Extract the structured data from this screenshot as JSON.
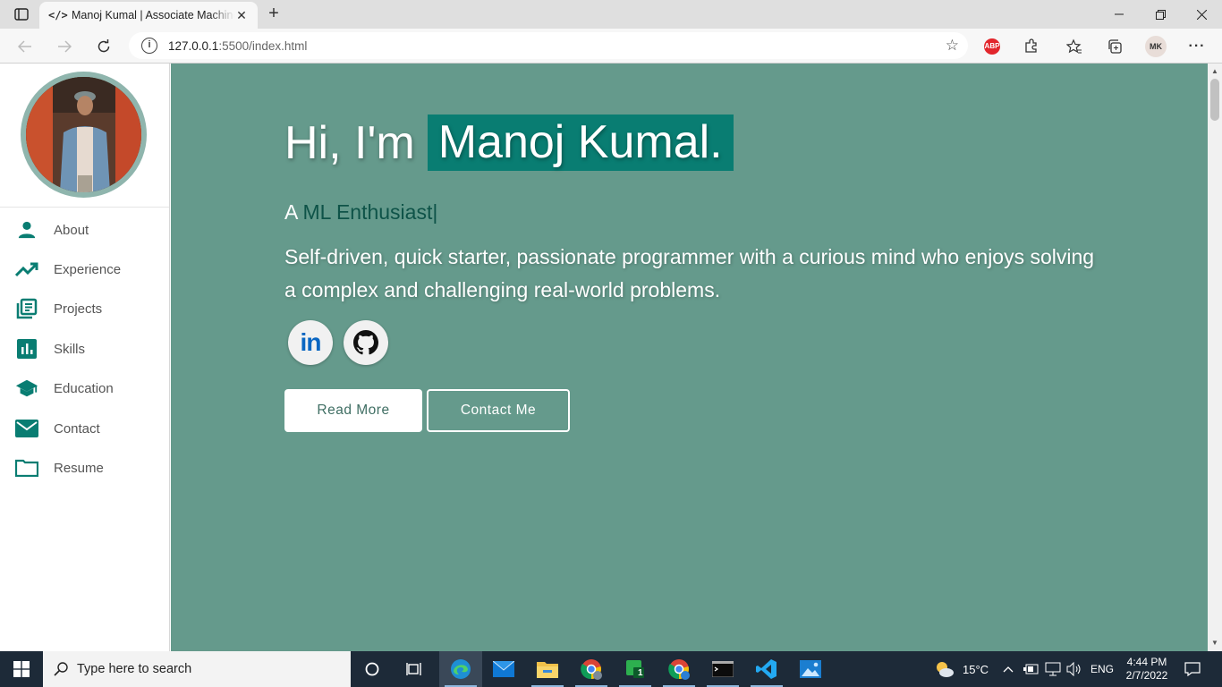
{
  "browser": {
    "tab_title": "Manoj Kumal | Associate Machine Learning Engineer",
    "url_host": "127.0.0.1",
    "url_path": ":5500/index.html",
    "profile_initials": "MK",
    "abp_label": "ABP"
  },
  "sidebar": {
    "items": [
      {
        "label": "About",
        "icon": "person-icon"
      },
      {
        "label": "Experience",
        "icon": "trending-up-icon"
      },
      {
        "label": "Projects",
        "icon": "library-books-icon"
      },
      {
        "label": "Skills",
        "icon": "bar-chart-icon"
      },
      {
        "label": "Education",
        "icon": "school-icon"
      },
      {
        "label": "Contact",
        "icon": "mail-icon"
      },
      {
        "label": "Resume",
        "icon": "folder-icon"
      }
    ],
    "accent": "#097d72"
  },
  "hero": {
    "greeting": "Hi, I'm",
    "name": "Manoj Kumal.",
    "subtitle_prefix": "A",
    "subtitle_typed": "ML Enthusiast",
    "cursor": "|",
    "description": "Self-driven, quick starter, passionate programmer with a curious mind who enjoys solving a complex and challenging real-world problems.",
    "read_more": "Read More",
    "contact_me": "Contact Me",
    "linkedin_label": "in",
    "background": "#659a8c"
  },
  "taskbar": {
    "search_placeholder": "Type here to search",
    "weather": "15°C",
    "language": "ENG",
    "time": "4:44 PM",
    "date": "2/7/2022",
    "badge_count": "1"
  }
}
